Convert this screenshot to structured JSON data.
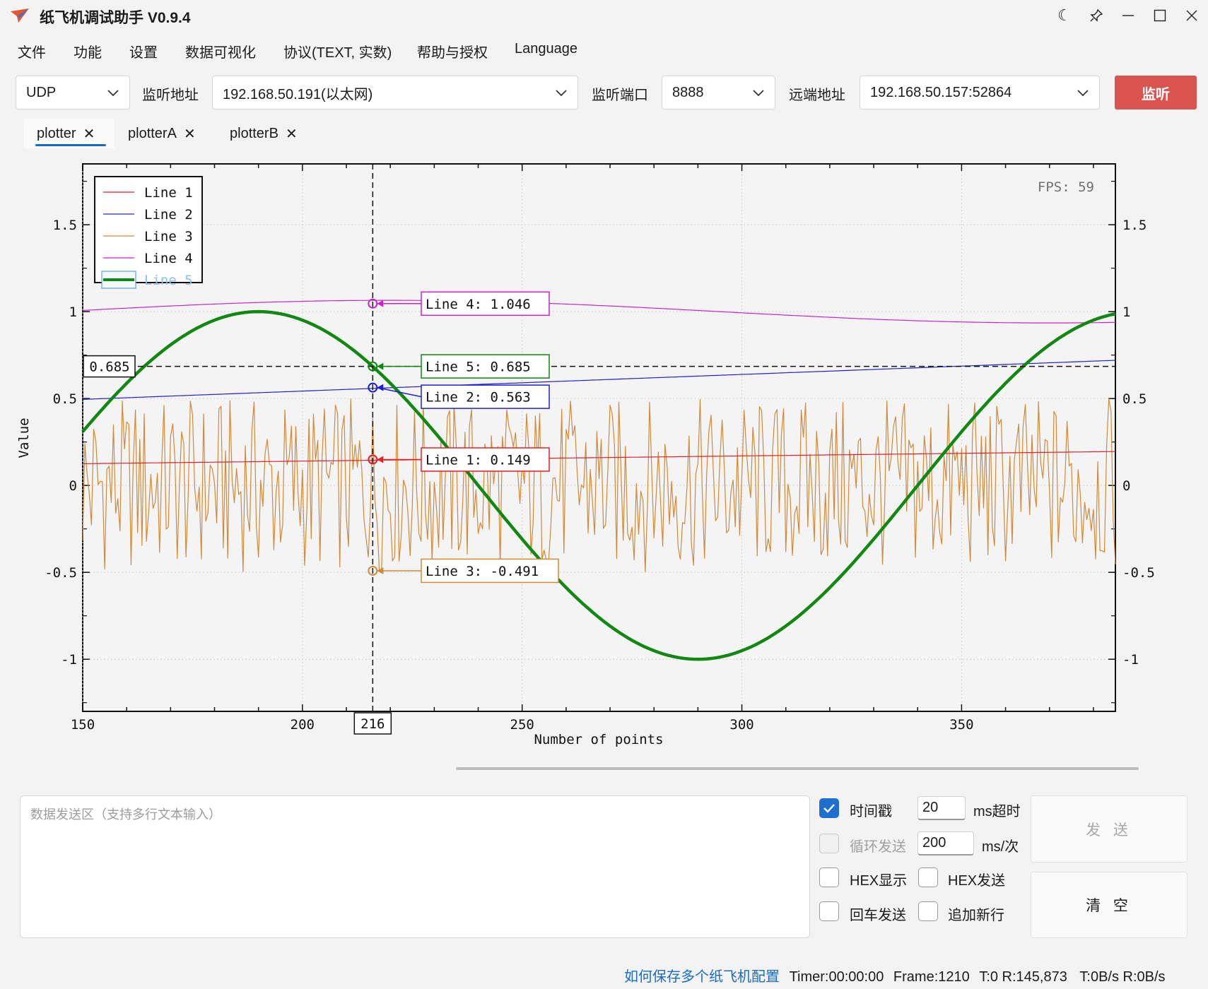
{
  "window": {
    "title": "纸飞机调试助手 V0.9.4",
    "controls": [
      "moon-icon",
      "pin-icon",
      "minimize-icon",
      "maximize-icon",
      "close-icon"
    ]
  },
  "menu": [
    "文件",
    "功能",
    "设置",
    "数据可视化",
    "协议(TEXT, 实数)",
    "帮助与授权",
    "Language"
  ],
  "toolbar": {
    "protocol": "UDP",
    "listen_address_label": "监听地址",
    "listen_address": "192.168.50.191(以太网)",
    "listen_port_label": "监听端口",
    "listen_port": "8888",
    "remote_address_label": "远端地址",
    "remote_address": "192.168.50.157:52864",
    "listen_button": "监听",
    "listen_button_color": "#d9534f"
  },
  "tabs": [
    {
      "label": "plotter",
      "active": true
    },
    {
      "label": "plotterA",
      "active": false
    },
    {
      "label": "plotterB",
      "active": false
    }
  ],
  "chart_data": {
    "type": "line",
    "xlabel": "Number of points",
    "ylabel": "Value",
    "xlim": [
      150,
      385
    ],
    "ylim": [
      -1.3,
      1.85
    ],
    "xticks": [
      150,
      200,
      250,
      300,
      350
    ],
    "yticks": [
      -1,
      -0.5,
      0,
      0.5,
      1,
      1.5
    ],
    "ytick_labels": [
      "-1",
      "-0.5",
      "0",
      "0.5",
      "1",
      "1.5"
    ],
    "grid": true,
    "legend_placement": "top-left",
    "fps_label": "FPS: 59",
    "cursor": {
      "x": 216,
      "x_label": "216",
      "y": 0.685,
      "y_label": "0.685",
      "readouts": [
        {
          "text": "Line 4: 1.046",
          "series": "Line 4",
          "value": 1.046
        },
        {
          "text": "Line 5: 0.685",
          "series": "Line 5",
          "value": 0.685
        },
        {
          "text": "Line 2: 0.563",
          "series": "Line 2",
          "value": 0.563
        },
        {
          "text": "Line 1: 0.149",
          "series": "Line 1",
          "value": 0.149
        },
        {
          "text": "Line 3: -0.491",
          "series": "Line 3",
          "value": -0.491
        }
      ]
    },
    "series": [
      {
        "name": "Line 1",
        "color": "#e0202a",
        "shape": "linear",
        "start": [
          150,
          0.125
        ],
        "end": [
          385,
          0.195
        ]
      },
      {
        "name": "Line 2",
        "color": "#2020d0",
        "shape": "linear",
        "start": [
          150,
          0.495
        ],
        "end": [
          385,
          0.72
        ]
      },
      {
        "name": "Line 3",
        "color": "#d08a3a",
        "shape": "noise",
        "range": [
          -0.5,
          0.5
        ]
      },
      {
        "name": "Line 4",
        "color": "#cc22cc",
        "shape": "sine",
        "offset": 1.0,
        "amplitude": 0.065,
        "period": 300,
        "peak_x": 220
      },
      {
        "name": "Line 5",
        "color": "#118811",
        "shape": "sine",
        "offset": 0,
        "amplitude": 1.0,
        "period": 200,
        "peak_x": 190,
        "bold": true,
        "dimmed_in_legend": true
      }
    ]
  },
  "send": {
    "placeholder": "数据发送区（支持多行文本输入）",
    "timestamp_label": "时间戳",
    "timestamp_checked": true,
    "timeout_value": "20",
    "timeout_unit": "ms超时",
    "loop_label": "循环发送",
    "loop_checked": false,
    "loop_value": "200",
    "loop_unit": "ms/次",
    "hex_display_label": "HEX显示",
    "hex_send_label": "HEX发送",
    "enter_send_label": "回车发送",
    "append_newline_label": "追加新行",
    "send_button": "发 送",
    "clear_button": "清 空"
  },
  "status": {
    "config_link": "如何保存多个纸飞机配置",
    "timer": "Timer:00:00:00",
    "frame": "Frame:1210",
    "counts": "T:0 R:145,873",
    "rates": "T:0B/s R:0B/s"
  }
}
